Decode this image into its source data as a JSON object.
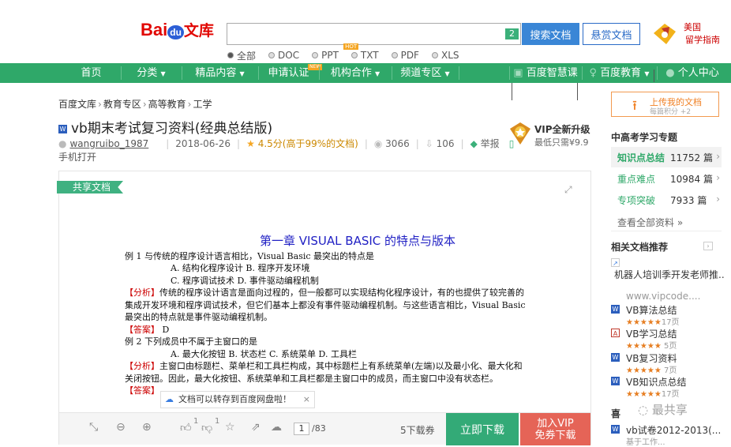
{
  "header": {
    "logo_bai": "Bai",
    "logo_du": "du",
    "logo_wenku": "文库",
    "search_badge": "2",
    "search_button": "搜索文档",
    "reward_button": "悬赏文档",
    "promo_line1": "美国",
    "promo_line2": "留学指南",
    "filters": [
      {
        "label": "全部",
        "selected": true
      },
      {
        "label": "DOC",
        "selected": false
      },
      {
        "label": "PPT",
        "selected": false,
        "badge": "HOT"
      },
      {
        "label": "TXT",
        "selected": false
      },
      {
        "label": "PDF",
        "selected": false
      },
      {
        "label": "XLS",
        "selected": false
      }
    ]
  },
  "nav": {
    "items": [
      "首页",
      "分类",
      "精品内容",
      "申请认证",
      "机构合作",
      "频道专区"
    ],
    "new_badge": "NEW",
    "right_items": [
      "百度智慧课",
      "百度教育",
      "个人中心"
    ]
  },
  "breadcrumb": [
    "百度文库",
    "教育专区",
    "高等教育",
    "工学"
  ],
  "document": {
    "title": "vb期末考试复习资料(经典总结版)",
    "author": "wangruibo_1987",
    "date": "2018-06-26",
    "rating": "4.5分(高于99%的文档)",
    "views": "3066",
    "downloads": "106",
    "report": "举报",
    "phone_open": "手机打开",
    "vip_upgrade": "VIP全新升级",
    "vip_price": "最低只需¥9.9",
    "share_tag": "共享文档",
    "content": {
      "chapter": "第一章 VISUAL BASIC 的特点与版本",
      "q1": "例 1 与传统的程序设计语言相比，Visual Basic 最突出的特点是",
      "q1_ab": "A. 结构化程序设计 B. 程序开发环境",
      "q1_cd": "C. 程序调试技术    D. 事件驱动编程机制",
      "analysis_label": "【分析】",
      "q1_analysis": "传统的程序设计语言是面向过程的，但一般都可以实现结构化程序设计，有的也提供了较完善的集成开发环境和程序调试技术，但它们基本上都没有事件驱动编程机制。与这些语言相比，Visual Basic最突出的特点就是事件驱动编程机制。",
      "answer_label": "【答案】",
      "q1_answer": "D",
      "q2": "例 2 下列成员中不属于主窗口的是",
      "q2_opts": "A. 最大化按钮 B. 状态栏 C. 系统菜单 D. 工具栏",
      "q2_analysis": "主窗口由标题栏、菜单栏和工具栏构成，其中标题栏上有系统菜单(左端)以及最小化、最大化和关闭按钮。因此，最大化按钮、系统菜单和工具栏都是主窗口中的成员，而主窗口中没有状态栏。"
    },
    "save_notice": "文档可以转存到百度网盘啦！"
  },
  "toolbar": {
    "like_count": "1",
    "dislike_count": "1",
    "page_current": "1",
    "page_total": "/83",
    "download_cost": "5下载券",
    "download_button": "立即下载",
    "vip_download_line1": "加入VIP",
    "vip_download_line2": "免券下载"
  },
  "sidebar": {
    "upload_label": "上传我的文档",
    "upload_sub": "每篇积分 +2",
    "hot_title": "中高考学习专题",
    "hot_items": [
      {
        "name": "知识点总结",
        "count": "11752 篇"
      },
      {
        "name": "重点难点",
        "count": "10984 篇"
      },
      {
        "name": "专项突破",
        "count": "7933 篇"
      }
    ],
    "see_all": "查看全部资料",
    "related_title": "相关文档推荐",
    "related": [
      {
        "title": "机器人培训季开发老师推..",
        "sub": "www.vipcode....",
        "icon": "ad"
      },
      {
        "title": "VB算法总结",
        "stars": "★★★★★",
        "pages": "17页",
        "icon": "word"
      },
      {
        "title": "VB学习总结",
        "stars": "★★★★★",
        "pages": "5页",
        "icon": "pdf"
      },
      {
        "title": "VB复习资料",
        "stars": "★★★★★",
        "pages": "7页",
        "icon": "word"
      },
      {
        "title": "VB知识点总结",
        "stars": "★★★★★",
        "pages": "17页",
        "icon": "word"
      },
      {
        "title": "vb试卷2012-2013(...",
        "sub": "基于工作...",
        "icon": "word"
      }
    ],
    "watermark": "最共享",
    "watermark_prefix": "喜"
  }
}
